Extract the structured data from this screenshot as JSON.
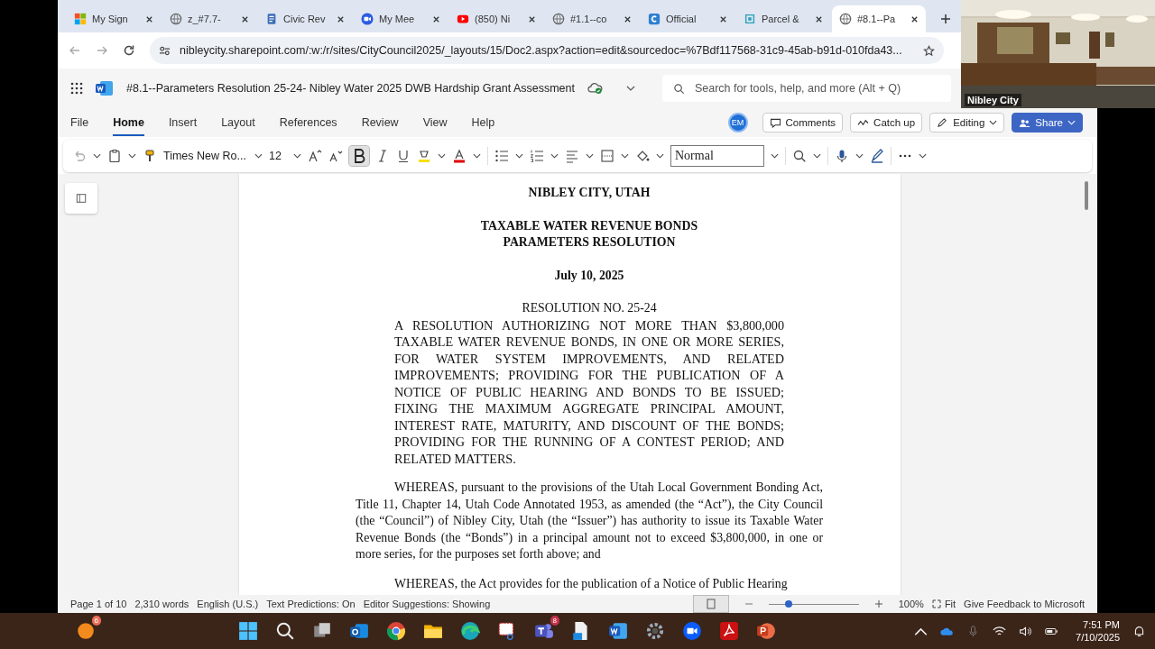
{
  "browser_tabs": [
    {
      "title": "My Sign",
      "kind": "windows",
      "selected": false
    },
    {
      "title": "z_#7.7-",
      "kind": "globe",
      "selected": false
    },
    {
      "title": "Civic Rev",
      "kind": "doc",
      "selected": false
    },
    {
      "title": "My Mee",
      "kind": "zoom",
      "selected": false
    },
    {
      "title": "(850) Ni",
      "kind": "youtube",
      "selected": false
    },
    {
      "title": "#1.1--co",
      "kind": "globe",
      "selected": false
    },
    {
      "title": "Official",
      "kind": "letter",
      "selected": false
    },
    {
      "title": "Parcel &",
      "kind": "parcel",
      "selected": false
    },
    {
      "title": "#8.1--Pa",
      "kind": "globe",
      "selected": true
    }
  ],
  "address": {
    "url": "nibleycity.sharepoint.com/:w:/r/sites/CityCouncil2025/_layouts/15/Doc2.aspx?action=edit&sourcedoc=%7Bdf117568-31c9-45ab-b91d-010fda43..."
  },
  "app_bar": {
    "document_title": "#8.1--Parameters Resolution 25-24- Nibley Water 2025 DWB Hardship Grant Assessment",
    "search_placeholder": "Search for tools, help, and more (Alt + Q)"
  },
  "ribbon_tabs": [
    {
      "label": "File",
      "selected": false
    },
    {
      "label": "Home",
      "selected": true
    },
    {
      "label": "Insert",
      "selected": false
    },
    {
      "label": "Layout",
      "selected": false
    },
    {
      "label": "References",
      "selected": false
    },
    {
      "label": "Review",
      "selected": false
    },
    {
      "label": "View",
      "selected": false
    },
    {
      "label": "Help",
      "selected": false
    }
  ],
  "user_initials": "EM",
  "actions": [
    "Comments",
    "Catch up",
    "Editing",
    "Share"
  ],
  "toolbar": {
    "font": "Times New Ro...",
    "size": "12",
    "bold": true,
    "style": "Normal"
  },
  "document": {
    "blocks": [
      {
        "kind": "bold",
        "text": "NIBLEY CITY, UTAH"
      },
      {
        "kind": "bold",
        "text": "TAXABLE WATER REVENUE BONDS"
      },
      {
        "kind": "bold",
        "text": "PARAMETERS RESOLUTION"
      },
      {
        "kind": "bold",
        "text": "July 10, 2025"
      },
      {
        "kind": "center",
        "text": "RESOLUTION NO. 25-24"
      },
      {
        "kind": "caps",
        "text": "A RESOLUTION AUTHORIZING NOT MORE THAN $3,800,000 TAXABLE WATER REVENUE BONDS, IN ONE OR MORE SERIES, FOR WATER SYSTEM IMPROVEMENTS, AND RELATED IMPROVEMENTS; PROVIDING FOR THE PUBLICATION OF A NOTICE OF PUBLIC HEARING AND BONDS TO BE ISSUED; FIXING THE MAXIMUM AGGREGATE PRINCIPAL AMOUNT, INTEREST RATE, MATURITY, AND DISCOUNT OF THE BONDS; PROVIDING FOR THE RUNNING OF A CONTEST PERIOD; AND RELATED MATTERS."
      },
      {
        "kind": "body",
        "text": "WHEREAS, pursuant to the provisions of the Utah Local Government Bonding Act, Title 11, Chapter 14, Utah Code Annotated 1953, as amended (the “Act”), the City Council (the “Council”) of Nibley City, Utah (the “Issuer”) has authority to issue its Taxable Water Revenue Bonds (the “Bonds”) in a principal amount not to exceed $3,800,000, in one or more series, for the purposes set forth above; and"
      },
      {
        "kind": "body",
        "text": "WHEREAS, the Act provides for the publication of a Notice of Public Hearing"
      }
    ]
  },
  "status": {
    "items": [
      "Page 1 of 10",
      "2,310 words",
      "English (U.S.)",
      "Text Predictions: On",
      "Editor Suggestions: Showing"
    ],
    "level": 0.22,
    "zoom": "100%",
    "fit": "Fit",
    "feedback": "Give Feedback to Microsoft"
  },
  "taskbar": {
    "notification_badge": "6",
    "teams_badge": "8",
    "time": "7:51 PM",
    "date": "7/10/2025"
  },
  "video": {
    "label": "Nibley City"
  }
}
